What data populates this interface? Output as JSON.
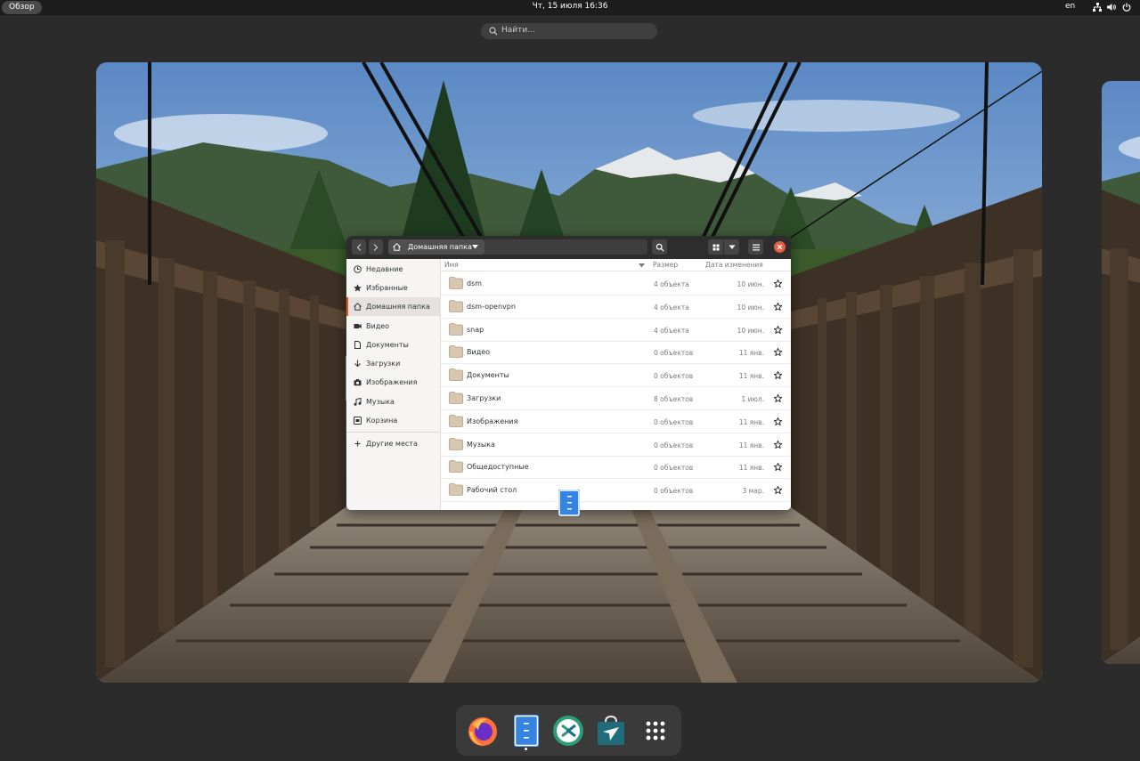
{
  "topbar": {
    "overview_label": "Обзор",
    "clock": "Чт, 15 июля  16:36",
    "language": "en",
    "tray_icons": [
      "network-icon",
      "volume-icon",
      "power-icon"
    ]
  },
  "search": {
    "placeholder": "Найти..."
  },
  "file_manager": {
    "path_label": "Домашняя папка",
    "sidebar": [
      {
        "label": "Недавние",
        "icon": "clock-icon"
      },
      {
        "label": "Избранные",
        "icon": "star-icon"
      },
      {
        "label": "Домашняя папка",
        "icon": "home-icon",
        "active": true
      },
      {
        "label": "Видео",
        "icon": "video-icon"
      },
      {
        "label": "Документы",
        "icon": "document-icon"
      },
      {
        "label": "Загрузки",
        "icon": "download-icon"
      },
      {
        "label": "Изображения",
        "icon": "camera-icon"
      },
      {
        "label": "Музыка",
        "icon": "music-icon"
      },
      {
        "label": "Корзина",
        "icon": "trash-icon"
      },
      {
        "label": "Другие места",
        "icon": "plus-icon"
      }
    ],
    "columns": {
      "name": "Имя",
      "size": "Размер",
      "modified": "Дата изменения"
    },
    "rows": [
      {
        "name": "dsm",
        "size": "4 объекта",
        "date": "10 июн."
      },
      {
        "name": "dsm-openvpn",
        "size": "4 объекта",
        "date": "10 июн."
      },
      {
        "name": "snap",
        "size": "4 объекта",
        "date": "10 июн."
      },
      {
        "name": "Видео",
        "size": "0 объектов",
        "date": "11 янв."
      },
      {
        "name": "Документы",
        "size": "0 объектов",
        "date": "11 янв."
      },
      {
        "name": "Загрузки",
        "size": "8 объектов",
        "date": "1 июл."
      },
      {
        "name": "Изображения",
        "size": "0 объектов",
        "date": "11 янв."
      },
      {
        "name": "Музыка",
        "size": "0 объектов",
        "date": "11 янв."
      },
      {
        "name": "Общедоступные",
        "size": "0 объектов",
        "date": "11 янв."
      },
      {
        "name": "Рабочий стол",
        "size": "0 объектов",
        "date": "3 мар."
      }
    ]
  },
  "dock": {
    "items": [
      "firefox-icon",
      "files-icon",
      "remmina-icon",
      "software-store-icon",
      "app-grid-icon"
    ],
    "active_item": "files-icon"
  },
  "colors": {
    "accent": "#e95420",
    "topbar": "#1d1d1d",
    "background": "#2b2b2b",
    "folder": "#c9b49a"
  }
}
